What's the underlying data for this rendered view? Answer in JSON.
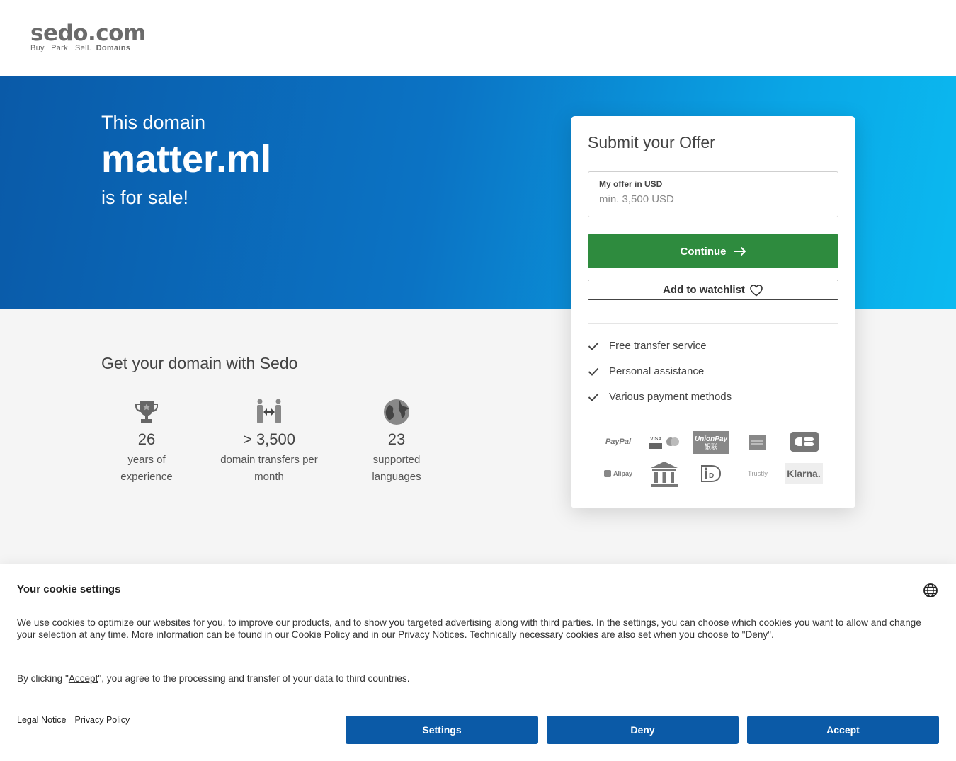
{
  "header": {
    "logo_main": "sedo.com",
    "logo_buy": "Buy.",
    "logo_park": "Park.",
    "logo_sell": "Sell.",
    "logo_domains": "Domains"
  },
  "hero": {
    "pre": "This domain",
    "domain": "matter.ml",
    "post": "is for sale!"
  },
  "section": {
    "title": "Get your domain with Sedo",
    "stats": [
      {
        "icon": "trophy-icon",
        "num": "26",
        "label1": "years of",
        "label2": "experience"
      },
      {
        "icon": "transfer-icon",
        "num": "> 3,500",
        "label1": "domain transfers per",
        "label2": "month"
      },
      {
        "icon": "globe-icon",
        "num": "23",
        "label1": "supported",
        "label2": "languages"
      }
    ]
  },
  "offer": {
    "title": "Submit your Offer",
    "input_label": "My offer in USD",
    "input_placeholder": "min. 3,500 USD",
    "continue_label": "Continue",
    "watchlist_label": "Add to watchlist",
    "features": [
      "Free transfer service",
      "Personal assistance",
      "Various payment methods"
    ],
    "payments": {
      "paypal": "PayPal",
      "unionpay": "UnionPay",
      "unionpay_cn": "银联",
      "alipay": "Alipay",
      "trustly": "Trustly",
      "klarna": "Klarna."
    }
  },
  "cookie": {
    "title": "Your cookie settings",
    "text_part1": "We use cookies to optimize our websites for you, to improve our products, and to show you targeted advertising along with third parties. In the settings, you can choose which cookies you want to allow and change your selection at any time. More information can be found in our ",
    "cookie_policy_link": "Cookie Policy",
    "text_part2": " and in our ",
    "privacy_notices_link": "Privacy Notices",
    "text_part3": ". Technically necessary cookies are also set when you choose to \"",
    "deny_link": "Deny",
    "text_part4": "\".",
    "text2_part1": "By clicking \"",
    "accept_link": "Accept",
    "text2_part2": "\", you agree to the processing and transfer of your data to third countries.",
    "legal_notice": "Legal Notice",
    "privacy_policy": "Privacy Policy",
    "btn_settings": "Settings",
    "btn_deny": "Deny",
    "btn_accept": "Accept"
  },
  "colors": {
    "primary_blue": "#0b5aa7",
    "continue_green": "#2e8b3e"
  }
}
